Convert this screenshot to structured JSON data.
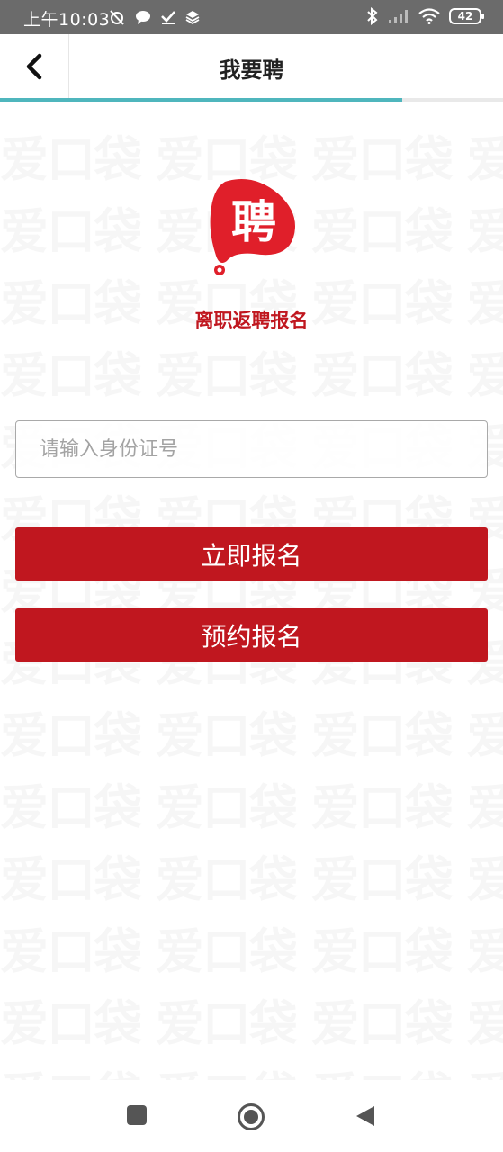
{
  "status_bar": {
    "time": "上午10:03",
    "battery": "42"
  },
  "header": {
    "title": "我要聘",
    "progress": 0.8
  },
  "watermark": {
    "text": "爱口袋"
  },
  "logo": {
    "glyph": "聘",
    "caption": "离职返聘报名"
  },
  "form": {
    "id_placeholder": "请输入身份证号",
    "id_value": ""
  },
  "buttons": {
    "register_now": "立即报名",
    "reserve_register": "预约报名"
  },
  "colors": {
    "brand_red": "#c0171f",
    "accent_teal": "#4fb6bd",
    "status_bar": "#6b6b6b"
  },
  "icons": {
    "back": "chevron-left-icon",
    "nav_recent": "square-icon",
    "nav_home": "circle-icon",
    "nav_back": "triangle-left-icon"
  }
}
